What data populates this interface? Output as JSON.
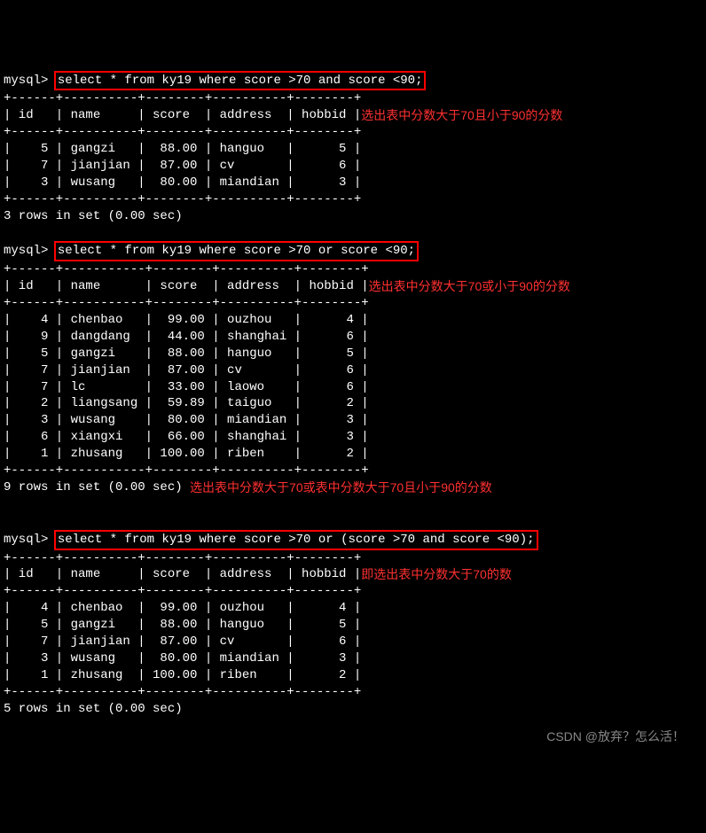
{
  "queries": {
    "q1": {
      "prompt": "mysql>",
      "sql": "select * from ky19 where score >70 and score <90;",
      "separator": "+------+----------+--------+----------+--------+",
      "headers": [
        "id",
        "name",
        "score",
        "address",
        "hobbid"
      ],
      "header_tail": "选出表中分数大于70且小于90的分数",
      "rows": [
        {
          "id": "5",
          "name": "gangzi",
          "score": "88.00",
          "address": "hanguo",
          "hobbid": "5"
        },
        {
          "id": "7",
          "name": "jianjian",
          "score": "87.00",
          "address": "cv",
          "hobbid": "6"
        },
        {
          "id": "3",
          "name": "wusang",
          "score": "80.00",
          "address": "miandian",
          "hobbid": "3"
        }
      ],
      "footer": "3 rows in set (0.00 sec)"
    },
    "q2": {
      "prompt": "mysql>",
      "sql": "select * from ky19 where score >70 or score <90;",
      "separator": "+------+-----------+--------+----------+--------+",
      "headers": [
        "id",
        "name",
        "score",
        "address",
        "hobbid"
      ],
      "header_tail": "选出表中分数大于70或小于90的分数",
      "rows": [
        {
          "id": "4",
          "name": "chenbao",
          "score": "99.00",
          "address": "ouzhou",
          "hobbid": "4"
        },
        {
          "id": "9",
          "name": "dangdang",
          "score": "44.00",
          "address": "shanghai",
          "hobbid": "6"
        },
        {
          "id": "5",
          "name": "gangzi",
          "score": "88.00",
          "address": "hanguo",
          "hobbid": "5"
        },
        {
          "id": "7",
          "name": "jianjian",
          "score": "87.00",
          "address": "cv",
          "hobbid": "6"
        },
        {
          "id": "7",
          "name": "lc",
          "score": "33.00",
          "address": "laowo",
          "hobbid": "6"
        },
        {
          "id": "2",
          "name": "liangsang",
          "score": "59.89",
          "address": "taiguo",
          "hobbid": "2"
        },
        {
          "id": "3",
          "name": "wusang",
          "score": "80.00",
          "address": "miandian",
          "hobbid": "3"
        },
        {
          "id": "6",
          "name": "xiangxi",
          "score": "66.00",
          "address": "shanghai",
          "hobbid": "3"
        },
        {
          "id": "1",
          "name": "zhusang",
          "score": "100.00",
          "address": "riben",
          "hobbid": "2"
        }
      ],
      "footer": "9 rows in set (0.00 sec)",
      "footer_tail": "选出表中分数大于70或表中分数大于70且小于90的分数"
    },
    "q3": {
      "prompt": "mysql>",
      "sql": "select * from ky19 where score >70 or (score >70 and score <90);",
      "separator": "+------+----------+--------+----------+--------+",
      "headers": [
        "id",
        "name",
        "score",
        "address",
        "hobbid"
      ],
      "header_tail": "即选出表中分数大于70的数",
      "rows": [
        {
          "id": "4",
          "name": "chenbao",
          "score": "99.00",
          "address": "ouzhou",
          "hobbid": "4"
        },
        {
          "id": "5",
          "name": "gangzi",
          "score": "88.00",
          "address": "hanguo",
          "hobbid": "5"
        },
        {
          "id": "7",
          "name": "jianjian",
          "score": "87.00",
          "address": "cv",
          "hobbid": "6"
        },
        {
          "id": "3",
          "name": "wusang",
          "score": "80.00",
          "address": "miandian",
          "hobbid": "3"
        },
        {
          "id": "1",
          "name": "zhusang",
          "score": "100.00",
          "address": "riben",
          "hobbid": "2"
        }
      ],
      "footer": "5 rows in set (0.00 sec)"
    }
  },
  "watermark": "CSDN @放弃？怎么活！",
  "chart_data": {
    "type": "table",
    "tables": [
      {
        "query": "select * from ky19 where score >70 and score <90;",
        "columns": [
          "id",
          "name",
          "score",
          "address",
          "hobbid"
        ],
        "rows": [
          [
            5,
            "gangzi",
            88.0,
            "hanguo",
            5
          ],
          [
            7,
            "jianjian",
            87.0,
            "cv",
            6
          ],
          [
            3,
            "wusang",
            80.0,
            "miandian",
            3
          ]
        ]
      },
      {
        "query": "select * from ky19 where score >70 or score <90;",
        "columns": [
          "id",
          "name",
          "score",
          "address",
          "hobbid"
        ],
        "rows": [
          [
            4,
            "chenbao",
            99.0,
            "ouzhou",
            4
          ],
          [
            9,
            "dangdang",
            44.0,
            "shanghai",
            6
          ],
          [
            5,
            "gangzi",
            88.0,
            "hanguo",
            5
          ],
          [
            7,
            "jianjian",
            87.0,
            "cv",
            6
          ],
          [
            7,
            "lc",
            33.0,
            "laowo",
            6
          ],
          [
            2,
            "liangsang",
            59.89,
            "taiguo",
            2
          ],
          [
            3,
            "wusang",
            80.0,
            "miandian",
            3
          ],
          [
            6,
            "xiangxi",
            66.0,
            "shanghai",
            3
          ],
          [
            1,
            "zhusang",
            100.0,
            "riben",
            2
          ]
        ]
      },
      {
        "query": "select * from ky19 where score >70 or (score >70 and score <90);",
        "columns": [
          "id",
          "name",
          "score",
          "address",
          "hobbid"
        ],
        "rows": [
          [
            4,
            "chenbao",
            99.0,
            "ouzhou",
            4
          ],
          [
            5,
            "gangzi",
            88.0,
            "hanguo",
            5
          ],
          [
            7,
            "jianjian",
            87.0,
            "cv",
            6
          ],
          [
            3,
            "wusang",
            80.0,
            "miandian",
            3
          ],
          [
            1,
            "zhusang",
            100.0,
            "riben",
            2
          ]
        ]
      }
    ]
  }
}
